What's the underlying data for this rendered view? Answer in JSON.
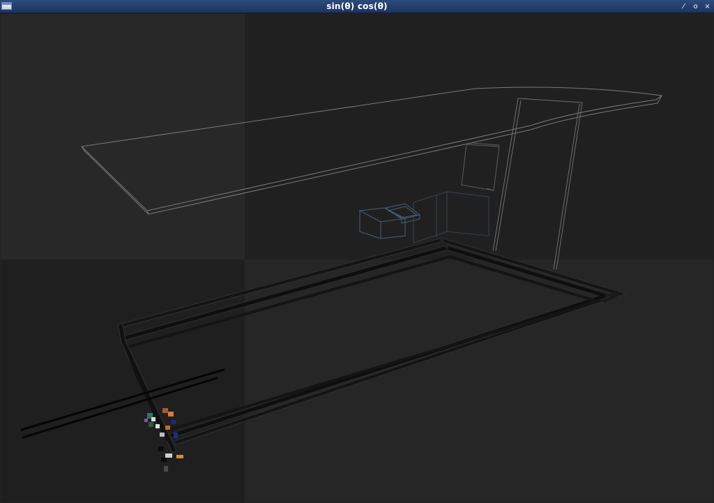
{
  "window": {
    "title": "sin(θ) cos(θ)",
    "controls": {
      "minimize": "⁄",
      "maximize": "o",
      "close": "×"
    }
  },
  "icons": {
    "app": "window-app-icon",
    "minimize": "minimize-icon",
    "maximize": "maximize-icon",
    "close": "close-icon"
  },
  "colors": {
    "titlebar": "#1d355e",
    "viewport_light": "#262626",
    "viewport_dark": "#1e1e1e",
    "wireframe": "#8a8a8a",
    "wireframe_blue": "#4a6078",
    "rails": "#0a0a0a"
  }
}
